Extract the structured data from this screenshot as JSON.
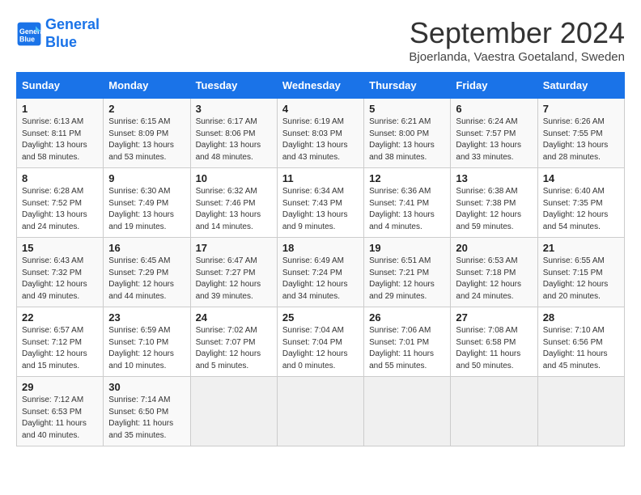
{
  "header": {
    "logo_line1": "General",
    "logo_line2": "Blue",
    "month": "September 2024",
    "location": "Bjoerlanda, Vaestra Goetaland, Sweden"
  },
  "weekdays": [
    "Sunday",
    "Monday",
    "Tuesday",
    "Wednesday",
    "Thursday",
    "Friday",
    "Saturday"
  ],
  "weeks": [
    [
      {
        "day": "1",
        "info": "Sunrise: 6:13 AM\nSunset: 8:11 PM\nDaylight: 13 hours\nand 58 minutes."
      },
      {
        "day": "2",
        "info": "Sunrise: 6:15 AM\nSunset: 8:09 PM\nDaylight: 13 hours\nand 53 minutes."
      },
      {
        "day": "3",
        "info": "Sunrise: 6:17 AM\nSunset: 8:06 PM\nDaylight: 13 hours\nand 48 minutes."
      },
      {
        "day": "4",
        "info": "Sunrise: 6:19 AM\nSunset: 8:03 PM\nDaylight: 13 hours\nand 43 minutes."
      },
      {
        "day": "5",
        "info": "Sunrise: 6:21 AM\nSunset: 8:00 PM\nDaylight: 13 hours\nand 38 minutes."
      },
      {
        "day": "6",
        "info": "Sunrise: 6:24 AM\nSunset: 7:57 PM\nDaylight: 13 hours\nand 33 minutes."
      },
      {
        "day": "7",
        "info": "Sunrise: 6:26 AM\nSunset: 7:55 PM\nDaylight: 13 hours\nand 28 minutes."
      }
    ],
    [
      {
        "day": "8",
        "info": "Sunrise: 6:28 AM\nSunset: 7:52 PM\nDaylight: 13 hours\nand 24 minutes."
      },
      {
        "day": "9",
        "info": "Sunrise: 6:30 AM\nSunset: 7:49 PM\nDaylight: 13 hours\nand 19 minutes."
      },
      {
        "day": "10",
        "info": "Sunrise: 6:32 AM\nSunset: 7:46 PM\nDaylight: 13 hours\nand 14 minutes."
      },
      {
        "day": "11",
        "info": "Sunrise: 6:34 AM\nSunset: 7:43 PM\nDaylight: 13 hours\nand 9 minutes."
      },
      {
        "day": "12",
        "info": "Sunrise: 6:36 AM\nSunset: 7:41 PM\nDaylight: 13 hours\nand 4 minutes."
      },
      {
        "day": "13",
        "info": "Sunrise: 6:38 AM\nSunset: 7:38 PM\nDaylight: 12 hours\nand 59 minutes."
      },
      {
        "day": "14",
        "info": "Sunrise: 6:40 AM\nSunset: 7:35 PM\nDaylight: 12 hours\nand 54 minutes."
      }
    ],
    [
      {
        "day": "15",
        "info": "Sunrise: 6:43 AM\nSunset: 7:32 PM\nDaylight: 12 hours\nand 49 minutes."
      },
      {
        "day": "16",
        "info": "Sunrise: 6:45 AM\nSunset: 7:29 PM\nDaylight: 12 hours\nand 44 minutes."
      },
      {
        "day": "17",
        "info": "Sunrise: 6:47 AM\nSunset: 7:27 PM\nDaylight: 12 hours\nand 39 minutes."
      },
      {
        "day": "18",
        "info": "Sunrise: 6:49 AM\nSunset: 7:24 PM\nDaylight: 12 hours\nand 34 minutes."
      },
      {
        "day": "19",
        "info": "Sunrise: 6:51 AM\nSunset: 7:21 PM\nDaylight: 12 hours\nand 29 minutes."
      },
      {
        "day": "20",
        "info": "Sunrise: 6:53 AM\nSunset: 7:18 PM\nDaylight: 12 hours\nand 24 minutes."
      },
      {
        "day": "21",
        "info": "Sunrise: 6:55 AM\nSunset: 7:15 PM\nDaylight: 12 hours\nand 20 minutes."
      }
    ],
    [
      {
        "day": "22",
        "info": "Sunrise: 6:57 AM\nSunset: 7:12 PM\nDaylight: 12 hours\nand 15 minutes."
      },
      {
        "day": "23",
        "info": "Sunrise: 6:59 AM\nSunset: 7:10 PM\nDaylight: 12 hours\nand 10 minutes."
      },
      {
        "day": "24",
        "info": "Sunrise: 7:02 AM\nSunset: 7:07 PM\nDaylight: 12 hours\nand 5 minutes."
      },
      {
        "day": "25",
        "info": "Sunrise: 7:04 AM\nSunset: 7:04 PM\nDaylight: 12 hours\nand 0 minutes."
      },
      {
        "day": "26",
        "info": "Sunrise: 7:06 AM\nSunset: 7:01 PM\nDaylight: 11 hours\nand 55 minutes."
      },
      {
        "day": "27",
        "info": "Sunrise: 7:08 AM\nSunset: 6:58 PM\nDaylight: 11 hours\nand 50 minutes."
      },
      {
        "day": "28",
        "info": "Sunrise: 7:10 AM\nSunset: 6:56 PM\nDaylight: 11 hours\nand 45 minutes."
      }
    ],
    [
      {
        "day": "29",
        "info": "Sunrise: 7:12 AM\nSunset: 6:53 PM\nDaylight: 11 hours\nand 40 minutes."
      },
      {
        "day": "30",
        "info": "Sunrise: 7:14 AM\nSunset: 6:50 PM\nDaylight: 11 hours\nand 35 minutes."
      },
      {
        "day": "",
        "info": ""
      },
      {
        "day": "",
        "info": ""
      },
      {
        "day": "",
        "info": ""
      },
      {
        "day": "",
        "info": ""
      },
      {
        "day": "",
        "info": ""
      }
    ]
  ]
}
